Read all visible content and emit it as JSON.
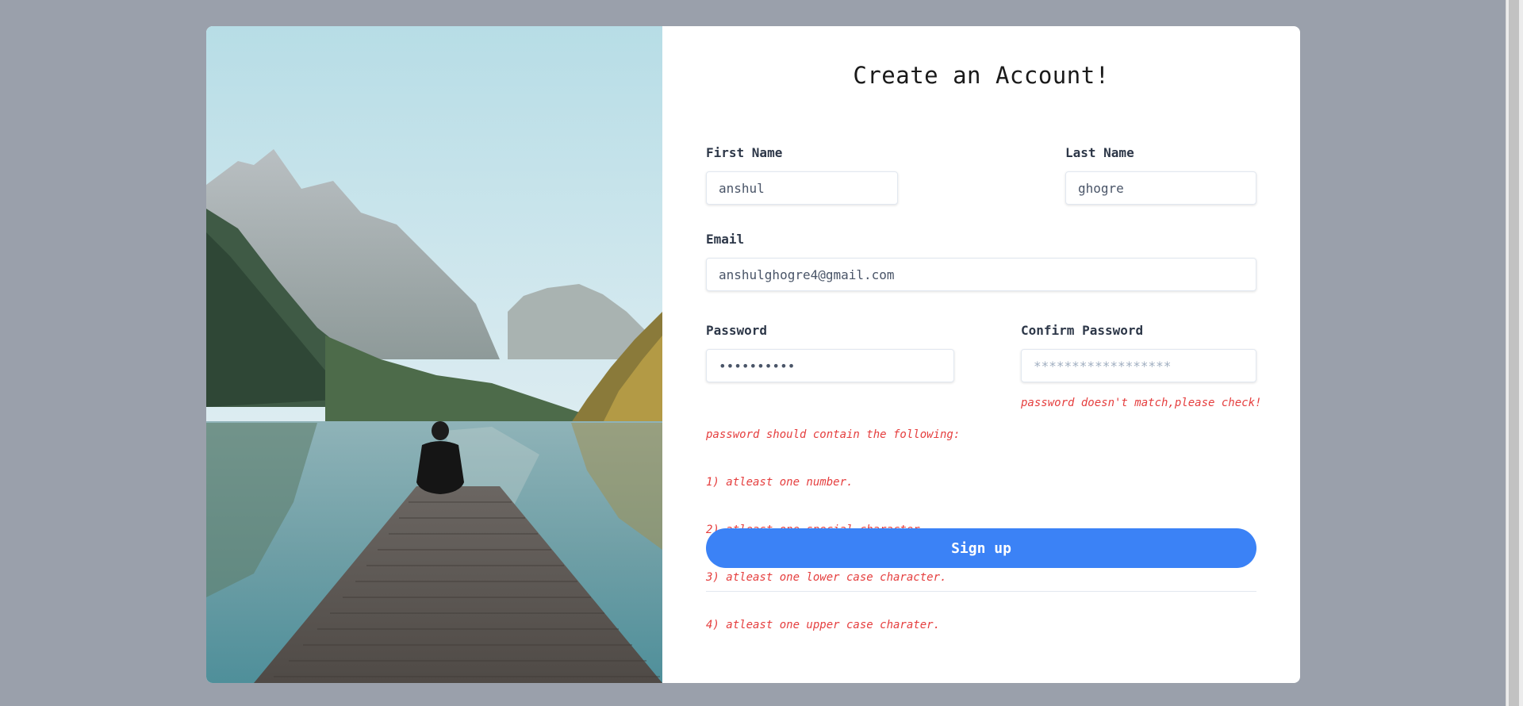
{
  "form": {
    "title": "Create an Account!",
    "first_name": {
      "label": "First Name",
      "value": "anshul"
    },
    "last_name": {
      "label": "Last Name",
      "value": "ghogre"
    },
    "email": {
      "label": "Email",
      "value": "anshulghogre4@gmail.com"
    },
    "password": {
      "label": "Password",
      "value": "anshul@123",
      "errors": [
        "password should contain the following:",
        "1) atleast one number.",
        "2) atleast one special character.",
        "3) atleast one lower case character.",
        "4) atleast one upper case charater."
      ]
    },
    "confirm_password": {
      "label": "Confirm Password",
      "placeholder": "******************",
      "error": "password doesn't match,please check!"
    },
    "signup_label": "Sign up"
  },
  "colors": {
    "page_background": "#9aa0ab",
    "button": "#3b82f6",
    "error_text": "#e53e3e"
  },
  "icons": {
    "hero_image": "mountain-lake-dock-photo"
  }
}
